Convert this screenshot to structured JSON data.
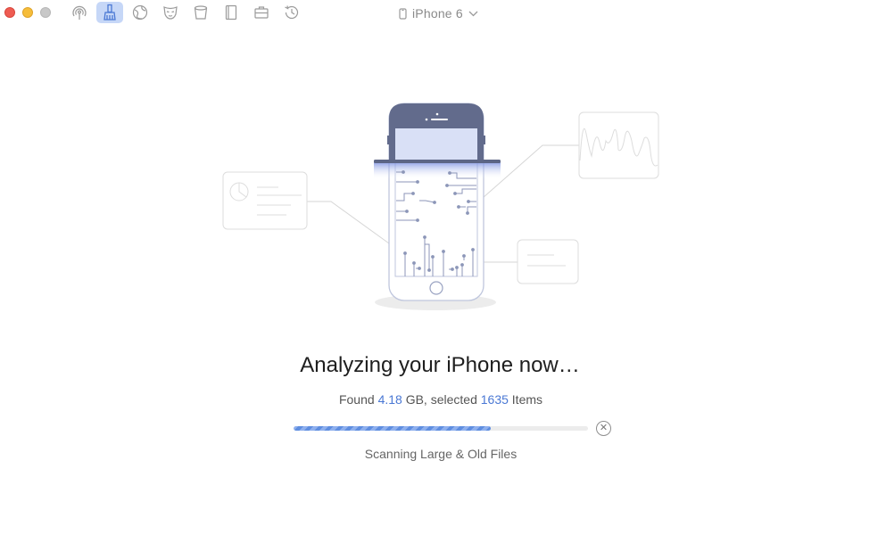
{
  "window": {
    "device_name": "iPhone 6"
  },
  "toolbar": {
    "tools": [
      {
        "icon": "airdrop-icon"
      },
      {
        "icon": "broom-icon",
        "active": true
      },
      {
        "icon": "globe-icon"
      },
      {
        "icon": "mask-icon"
      },
      {
        "icon": "bucket-icon"
      },
      {
        "icon": "book-icon"
      },
      {
        "icon": "toolbox-icon"
      },
      {
        "icon": "history-icon"
      }
    ]
  },
  "main": {
    "headline": "Analyzing your iPhone now…",
    "found_prefix": "Found ",
    "found_size": "4.18",
    "found_mid": " GB, selected ",
    "found_count": "1635",
    "found_suffix": " Items",
    "progress_percent": 67,
    "status": "Scanning Large & Old Files"
  },
  "colors": {
    "accent": "#4a78d4",
    "progress": "#5f8ee0",
    "active_tool": "#c6d7f7"
  }
}
